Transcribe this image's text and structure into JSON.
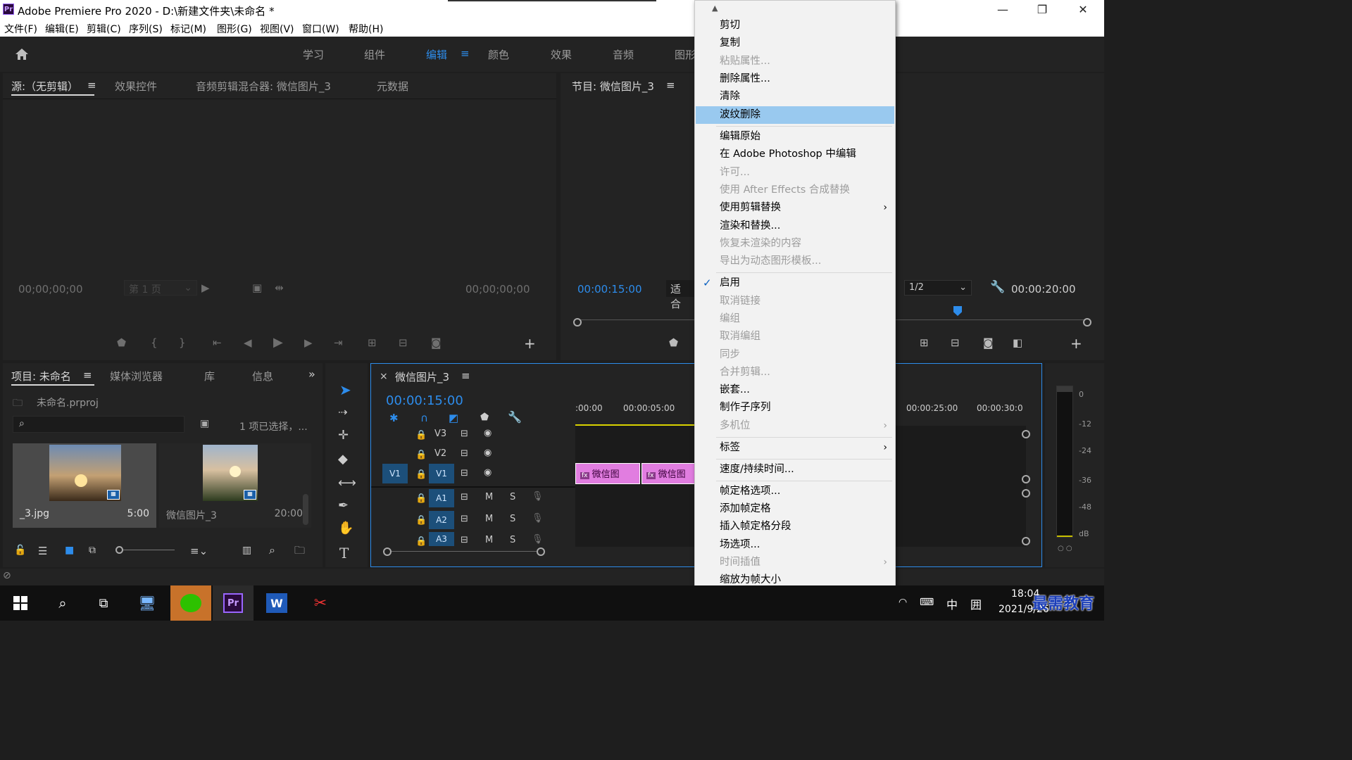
{
  "window": {
    "title": "Adobe Premiere Pro 2020 - D:\\新建文件夹\\未命名 *",
    "app_icon": "Pr"
  },
  "menu": [
    "文件(F)",
    "编辑(E)",
    "剪辑(C)",
    "序列(S)",
    "标记(M)",
    "图形(G)",
    "视图(V)",
    "窗口(W)",
    "帮助(H)"
  ],
  "workspaces": {
    "tabs": [
      "学习",
      "组件",
      "编辑",
      "颜色",
      "效果",
      "音频",
      "图形"
    ],
    "active": "编辑"
  },
  "source_panel": {
    "tabs": [
      "源:（无剪辑）",
      "效果控件",
      "音频剪辑混合器: 微信图片_3",
      "元数据"
    ],
    "timecode_left": "00;00;00;00",
    "timecode_right": "00;00;00;00",
    "page": "第 1 页"
  },
  "program_panel": {
    "title": "节目: 微信图片_3",
    "timecode_left": "00:00:15:00",
    "fit": "适合",
    "resolution": "1/2",
    "timecode_right": "00:00:20:00"
  },
  "project_panel": {
    "tabs": [
      "项目: 未命名",
      "媒体浏览器",
      "库",
      "信息"
    ],
    "file": "未命名.prproj",
    "selection_info": "1 项已选择，...",
    "items": [
      {
        "name": "_3.jpg",
        "duration": "5:00"
      },
      {
        "name": "微信图片_3",
        "duration": "20:00"
      }
    ]
  },
  "timeline": {
    "title": "微信图片_3",
    "timecode": "00:00:15:00",
    "ruler": [
      ":00:00",
      "00:00:05:00",
      "00:00:25:00",
      "00:00:30:0"
    ],
    "video_tracks": [
      "V3",
      "V2",
      "V1"
    ],
    "audio_tracks": [
      "A1",
      "A2",
      "A3"
    ],
    "source_patch": "V1",
    "mute": "M",
    "solo": "S",
    "clips": [
      "微信图",
      "微信图"
    ]
  },
  "meter": {
    "scale": [
      "0",
      "-12",
      "-24",
      "-36",
      "-48",
      "dB"
    ]
  },
  "context_menu": {
    "items": [
      {
        "label": "剪切",
        "disabled": false
      },
      {
        "label": "复制",
        "disabled": false
      },
      {
        "label": "粘贴属性...",
        "disabled": true
      },
      {
        "label": "删除属性...",
        "disabled": false
      },
      {
        "label": "清除",
        "disabled": false
      },
      {
        "label": "波纹删除",
        "disabled": false,
        "highlighted": true
      },
      {
        "label": "编辑原始",
        "disabled": false
      },
      {
        "label": "在 Adobe Photoshop 中编辑",
        "disabled": false
      },
      {
        "label": "许可...",
        "disabled": true
      },
      {
        "label": "使用 After Effects 合成替换",
        "disabled": true
      },
      {
        "label": "使用剪辑替换",
        "disabled": false,
        "submenu": true
      },
      {
        "label": "渲染和替换...",
        "disabled": false
      },
      {
        "label": "恢复未渲染的内容",
        "disabled": true
      },
      {
        "label": "导出为动态图形模板...",
        "disabled": true
      },
      {
        "label": "启用",
        "disabled": false,
        "checked": true
      },
      {
        "label": "取消链接",
        "disabled": true
      },
      {
        "label": "编组",
        "disabled": true
      },
      {
        "label": "取消编组",
        "disabled": true
      },
      {
        "label": "同步",
        "disabled": true
      },
      {
        "label": "合并剪辑...",
        "disabled": true
      },
      {
        "label": "嵌套...",
        "disabled": false
      },
      {
        "label": "制作子序列",
        "disabled": false
      },
      {
        "label": "多机位",
        "disabled": true,
        "submenu": true
      },
      {
        "label": "标签",
        "disabled": false,
        "submenu": true
      },
      {
        "label": "速度/持续时间...",
        "disabled": false
      },
      {
        "label": "帧定格选项...",
        "disabled": false
      },
      {
        "label": "添加帧定格",
        "disabled": false
      },
      {
        "label": "插入帧定格分段",
        "disabled": false
      },
      {
        "label": "场选项...",
        "disabled": false
      },
      {
        "label": "时间插值",
        "disabled": true,
        "submenu": true
      },
      {
        "label": "缩放为帧大小",
        "disabled": false
      }
    ]
  },
  "taskbar": {
    "time": "18:04",
    "date": "2021/9/26",
    "ime": "中",
    "watermark": "最需教育"
  },
  "colors": {
    "accent_blue": "#2d8ceb",
    "highlight": "#99c9ef",
    "clip_pink": "#e17de0"
  }
}
